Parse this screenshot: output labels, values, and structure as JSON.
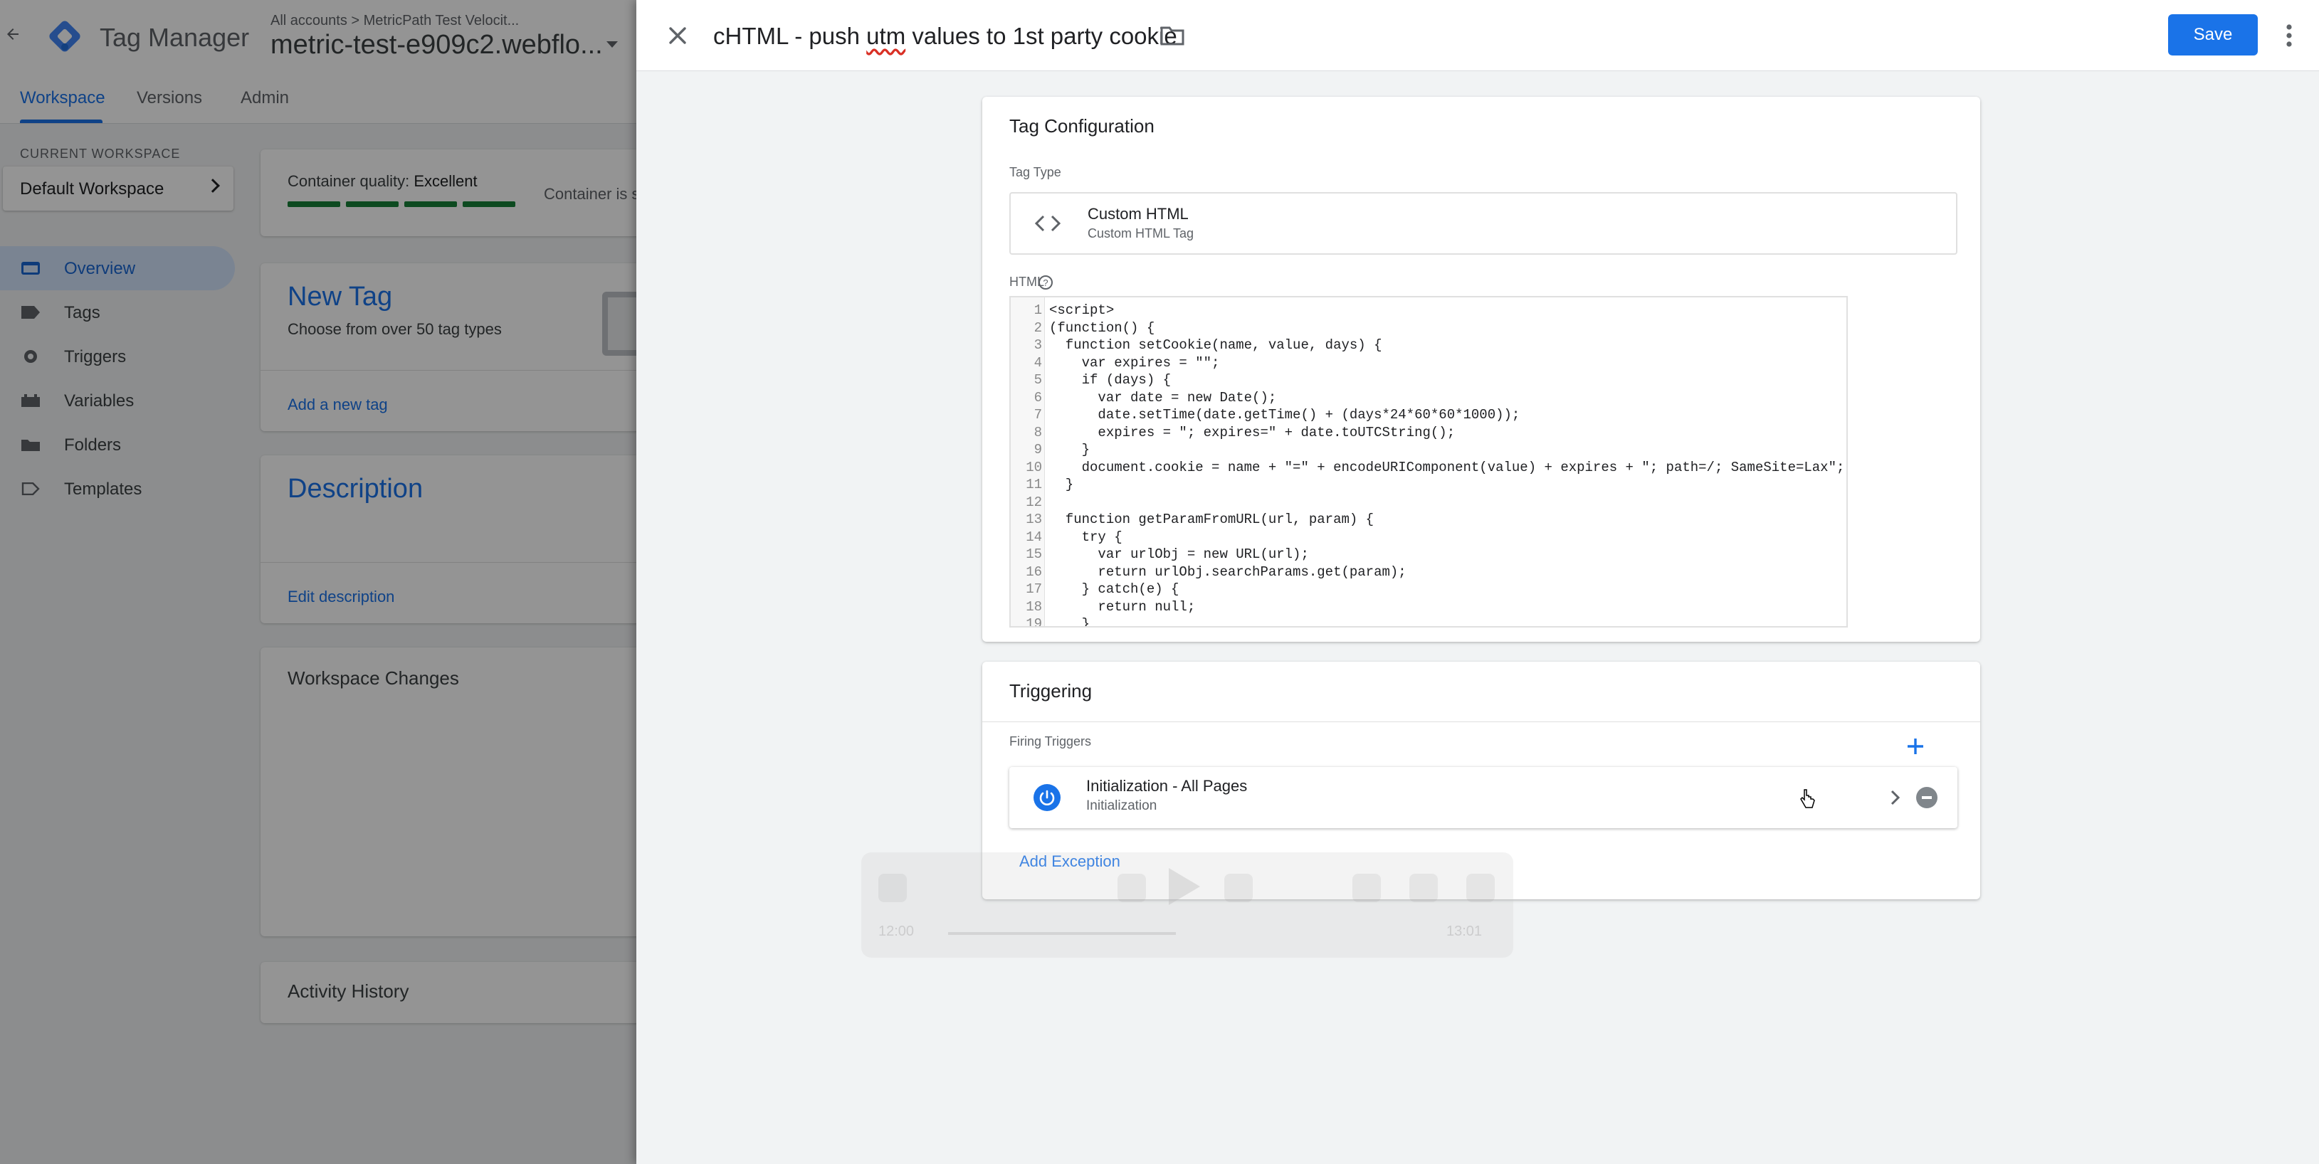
{
  "app": {
    "product_name": "Tag Manager",
    "breadcrumb": "All accounts > MetricPath Test Velocit...",
    "container_name": "metric-test-e909c2.webflo...",
    "tabs": [
      "Workspace",
      "Versions",
      "Admin"
    ],
    "active_tab": "Workspace"
  },
  "sidebar": {
    "current_workspace_label": "CURRENT WORKSPACE",
    "workspace_name": "Default Workspace",
    "items": [
      {
        "label": "Overview",
        "icon": "overview-icon",
        "active": true
      },
      {
        "label": "Tags",
        "icon": "tag-icon",
        "active": false
      },
      {
        "label": "Triggers",
        "icon": "trigger-icon",
        "active": false
      },
      {
        "label": "Variables",
        "icon": "variables-icon",
        "active": false
      },
      {
        "label": "Folders",
        "icon": "folder-icon",
        "active": false
      },
      {
        "label": "Templates",
        "icon": "templates-icon",
        "active": false
      }
    ]
  },
  "overview": {
    "container_quality_label": "Container quality:",
    "container_quality_value": "Excellent",
    "container_extra": "Container is s",
    "new_tag_title": "New Tag",
    "new_tag_subtitle": "Choose from over 50 tag types",
    "add_new_tag_link": "Add a new tag",
    "description_title": "Description",
    "edit_description_link": "Edit description",
    "workspace_changes_title": "Workspace Changes",
    "activity_history_title": "Activity History"
  },
  "editor": {
    "tag_name_pre": "cHTML - push ",
    "tag_name_utm": "utm",
    "tag_name_post": " values to 1st party cookie",
    "save_label": "Save",
    "tag_config_title": "Tag Configuration",
    "tag_type_label": "Tag Type",
    "tag_type_name": "Custom HTML",
    "tag_type_sub": "Custom HTML Tag",
    "html_label": "HTML",
    "code_lines": [
      "<script>",
      "(function() {",
      "  function setCookie(name, value, days) {",
      "    var expires = \"\";",
      "    if (days) {",
      "      var date = new Date();",
      "      date.setTime(date.getTime() + (days*24*60*60*1000));",
      "      expires = \"; expires=\" + date.toUTCString();",
      "    }",
      "    document.cookie = name + \"=\" + encodeURIComponent(value) + expires + \"; path=/; SameSite=Lax\";",
      "  }",
      "",
      "  function getParamFromURL(url, param) {",
      "    try {",
      "      var urlObj = new URL(url);",
      "      return urlObj.searchParams.get(param);",
      "    } catch(e) {",
      "      return null;",
      "    }"
    ],
    "triggering_title": "Triggering",
    "firing_triggers_label": "Firing Triggers",
    "trigger_name": "Initialization - All Pages",
    "trigger_type": "Initialization",
    "add_exception_label": "Add Exception"
  },
  "video_overlay": {
    "time_left": "12:00",
    "time_right": "13:01"
  },
  "colors": {
    "accent": "#1a73e8",
    "quality_green": "#188038",
    "sidebar_active_bg": "#d2e3fc"
  }
}
